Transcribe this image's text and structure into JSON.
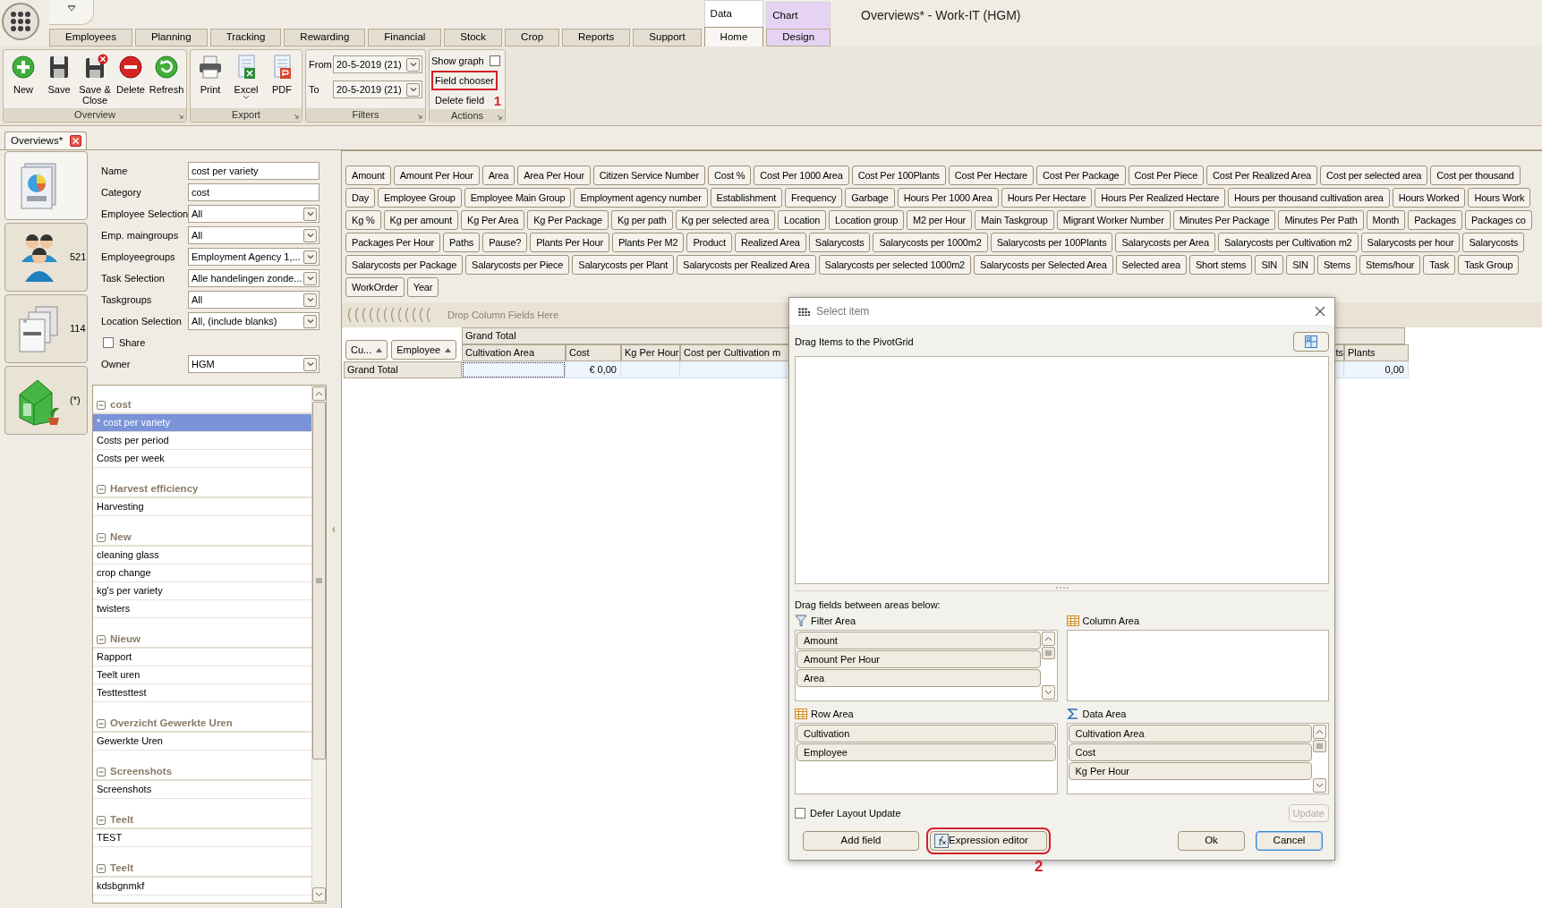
{
  "window_title": "Overviews* - Work-IT (HGM)",
  "ribbon_tabs": [
    {
      "label": "Employees",
      "selected": false
    },
    {
      "label": "Planning",
      "selected": false
    },
    {
      "label": "Tracking",
      "selected": false
    },
    {
      "label": "Rewarding",
      "selected": false
    },
    {
      "label": "Financial",
      "selected": false
    },
    {
      "label": "Stock",
      "selected": false
    },
    {
      "label": "Crop",
      "selected": false
    },
    {
      "label": "Reports",
      "selected": false
    },
    {
      "label": "Support",
      "selected": false
    }
  ],
  "context_groups": [
    {
      "label": "Data",
      "color": "#ffffff",
      "tabs": [
        {
          "label": "Home",
          "selected": true
        }
      ]
    },
    {
      "label": "Chart",
      "color": "#e6d3f3",
      "tabs": [
        {
          "label": "Design",
          "selected": false
        }
      ]
    }
  ],
  "ribbon_groups": [
    {
      "title": "Overview",
      "kind": "buttons",
      "buttons": [
        {
          "label": "New"
        },
        {
          "label": "Save"
        },
        {
          "label": "Save & Close"
        },
        {
          "label": "Delete"
        },
        {
          "label": "Refresh"
        }
      ]
    },
    {
      "title": "Export",
      "kind": "buttons",
      "buttons": [
        {
          "label": "Print"
        },
        {
          "label": "Excel",
          "dropdown": true
        },
        {
          "label": "PDF"
        }
      ]
    },
    {
      "title": "Filters",
      "kind": "dates",
      "fields": [
        {
          "label": "From",
          "value": "20-5-2019 (21)"
        },
        {
          "label": "To",
          "value": "20-5-2019 (21)"
        }
      ]
    },
    {
      "title": "Actions",
      "kind": "actions",
      "callout": "1",
      "items": [
        {
          "kind": "checkbox",
          "label": "Show graph",
          "checked": false
        },
        {
          "kind": "link",
          "label": "Field chooser",
          "highlighted": true
        },
        {
          "kind": "link",
          "label": "Delete field",
          "highlighted": false
        }
      ]
    }
  ],
  "document_tabs": [
    {
      "label": "Overviews*",
      "selected": true
    }
  ],
  "nav_tiles": [
    {
      "selected": true
    },
    {
      "count": "521",
      "selected": false
    },
    {
      "count": "114",
      "selected": false
    },
    {
      "count": "(*)",
      "selected": false
    }
  ],
  "form": [
    {
      "kind": "text",
      "label": "Name",
      "value": "cost per variety"
    },
    {
      "kind": "text",
      "label": "Category",
      "value": "cost"
    },
    {
      "kind": "select",
      "label": "Employee Selection",
      "value": "All"
    },
    {
      "kind": "select",
      "label": "Emp. maingroups",
      "value": "All"
    },
    {
      "kind": "select",
      "label": "Employeegroups",
      "value": "Employment Agency 1,..."
    },
    {
      "kind": "select",
      "label": "Task Selection",
      "value": "Alle handelingen zonde..."
    },
    {
      "kind": "select",
      "label": "Taskgroups",
      "value": "All"
    },
    {
      "kind": "select",
      "label": "Location Selection",
      "value": "All, (include blanks)"
    },
    {
      "kind": "checkbox",
      "label": "Share",
      "checked": false
    },
    {
      "kind": "select",
      "label": "Owner",
      "value": "HGM"
    }
  ],
  "overview_tree": [
    {
      "label": "cost",
      "expanded": true,
      "children": [
        {
          "label": "* cost per variety",
          "selected": true
        },
        {
          "label": "Costs per period",
          "selected": false
        },
        {
          "label": "Costs per week",
          "selected": false
        }
      ]
    },
    {
      "label": "Harvest efficiency",
      "expanded": true,
      "children": [
        {
          "label": "Harvesting",
          "selected": false
        }
      ]
    },
    {
      "label": "New",
      "expanded": true,
      "children": [
        {
          "label": "cleaning glass",
          "selected": false
        },
        {
          "label": "crop change",
          "selected": false
        },
        {
          "label": "kg's per variety",
          "selected": false
        },
        {
          "label": "twisters",
          "selected": false
        }
      ]
    },
    {
      "label": "Nieuw",
      "expanded": true,
      "children": [
        {
          "label": "Rapport",
          "selected": false
        },
        {
          "label": "Teelt uren",
          "selected": false
        },
        {
          "label": "Testtesttest",
          "selected": false
        }
      ]
    },
    {
      "label": "Overzicht Gewerkte Uren",
      "expanded": true,
      "children": [
        {
          "label": "Gewerkte Uren",
          "selected": false
        }
      ]
    },
    {
      "label": "Screenshots",
      "expanded": true,
      "children": [
        {
          "label": "Screenshots",
          "selected": false
        }
      ]
    },
    {
      "label": "Teelt",
      "expanded": true,
      "children": [
        {
          "label": "TEST",
          "selected": false
        }
      ]
    },
    {
      "label": "Teelt",
      "expanded": true,
      "children": [
        {
          "label": "kdsbgnmkf",
          "selected": false
        }
      ]
    }
  ],
  "field_list": [
    [
      "Amount",
      "Amount Per Hour",
      "Area",
      "Area Per Hour",
      "Citizen Service Number",
      "Cost %",
      "Cost Per 1000 Area",
      "Cost Per 100Plants",
      "Cost Per Hectare",
      "Cost Per Package",
      "Cost Per Piece",
      "Cost Per Realized Area",
      "Cost per selected area",
      "Cost per thousand"
    ],
    [
      "Day",
      "Employee Group",
      "Employee Main Group",
      "Employment agency number",
      "Establishment",
      "Frequency",
      "Garbage",
      "Hours Per 1000 Area",
      "Hours Per Hectare",
      "Hours Per Realized Hectare",
      "Hours per thousand cultivation area",
      "Hours Worked",
      "Hours Work"
    ],
    [
      "Kg %",
      "Kg per amount",
      "Kg Per Area",
      "Kg Per Package",
      "Kg per path",
      "Kg per selected area",
      "Location",
      "Location group",
      "M2 per Hour",
      "Main Taskgroup",
      "Migrant Worker Number",
      "Minutes Per Package",
      "Minutes Per Path",
      "Month",
      "Packages",
      "Packages co"
    ],
    [
      "Packages Per Hour",
      "Paths",
      "Pause?",
      "Plants Per Hour",
      "Plants Per M2",
      "Product",
      "Realized Area",
      "Salarycosts",
      "Salarycosts per 1000m2",
      "Salarycosts per 100Plants",
      "Salarycosts per Area",
      "Salarycosts per Cultivation m2",
      "Salarycosts per hour",
      "Salarycosts"
    ],
    [
      "Salarycosts per Package",
      "Salarycosts per Piece",
      "Salarycosts per Plant",
      "Salarycosts per Realized Area",
      "Salarycosts per selected 1000m2",
      "Salarycosts per Selected Area",
      "Selected area",
      "Short stems",
      "SIN",
      "SIN",
      "Stems",
      "Stems/hour",
      "Task",
      "Task Group"
    ],
    [
      "WorkOrder",
      "Year"
    ]
  ],
  "pivot": {
    "drop_hint": "Drop Column Fields Here",
    "row_fields": [
      {
        "label": "Cu..."
      },
      {
        "label": "Employee"
      }
    ],
    "grand_total_header": "Grand Total",
    "columns": [
      {
        "label": "Cultivation Area",
        "focused": true
      },
      {
        "label": "Cost",
        "grand_total": "€ 0,00",
        "focused": false
      },
      {
        "label": "Kg Per Hour",
        "focused": false
      },
      {
        "label": "Cost per Cultivation m",
        "focused": false
      },
      {
        "label": "ts",
        "focused": false
      },
      {
        "label": "Plants",
        "grand_total": "0,00",
        "focused": false
      }
    ],
    "row_label": "Grand Total"
  },
  "dialog": {
    "title": "Select item",
    "hint": "Drag Items to the PivotGrid",
    "areas_hint": "Drag fields between areas below:",
    "areas": [
      {
        "kind": "filter",
        "label": "Filter Area",
        "fields": [
          "Amount",
          "Amount Per Hour",
          "Area"
        ]
      },
      {
        "kind": "column",
        "label": "Column Area"
      },
      {
        "kind": "row",
        "label": "Row Area",
        "fields": [
          "Cultivation",
          "Employee"
        ]
      },
      {
        "kind": "data",
        "label": "Data Area",
        "fields": [
          "Cultivation Area",
          "Cost",
          "Kg Per Hour"
        ]
      }
    ],
    "defer": {
      "label": "Defer Layout Update",
      "checked": false
    },
    "update_button": {
      "label": "Update",
      "disabled": true
    },
    "buttons": [
      {
        "kind": "plain",
        "label": "Add field",
        "highlighted": false,
        "default": false
      },
      {
        "kind": "fx",
        "label": "Expression editor",
        "highlighted": true,
        "default": false
      },
      {
        "kind": "plain",
        "label": "Ok",
        "highlighted": false,
        "default": false
      },
      {
        "kind": "plain",
        "label": "Cancel",
        "highlighted": false,
        "default": true
      }
    ],
    "callout": "2"
  }
}
